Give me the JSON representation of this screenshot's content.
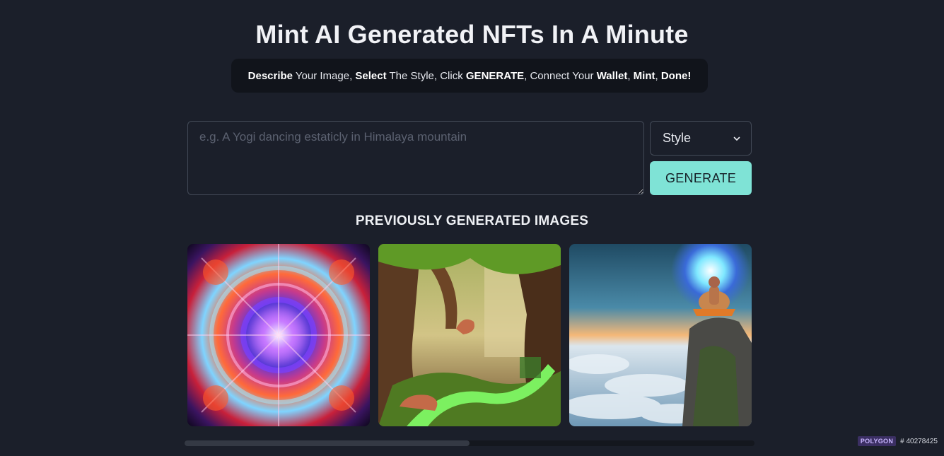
{
  "header": {
    "title": "Mint AI Generated NFTs In A Minute",
    "steps": [
      {
        "text": "Describe",
        "bold": true
      },
      {
        "text": " Your Image, ",
        "bold": false
      },
      {
        "text": "Select",
        "bold": true
      },
      {
        "text": " The Style, Click ",
        "bold": false
      },
      {
        "text": "GENERATE",
        "bold": true
      },
      {
        "text": ", Connect Your ",
        "bold": false
      },
      {
        "text": "Wallet",
        "bold": true
      },
      {
        "text": ", ",
        "bold": false
      },
      {
        "text": "Mint",
        "bold": true
      },
      {
        "text": ", ",
        "bold": false
      },
      {
        "text": "Done!",
        "bold": true
      }
    ]
  },
  "form": {
    "prompt_value": "",
    "prompt_placeholder": "e.g. A Yogi dancing estaticly in Himalaya mountain",
    "style_label": "Style",
    "style_icon": "chevron-down-icon",
    "generate_label": "GENERATE"
  },
  "gallery": {
    "title": "PREVIOUSLY GENERATED IMAGES",
    "images": [
      {
        "subject": "psychedelic cosmic mandala"
      },
      {
        "subject": "mystical forest with mushrooms"
      },
      {
        "subject": "yogi meditating above clouds"
      }
    ],
    "scroll_fraction": 0.5
  },
  "footer": {
    "network": "POLYGON",
    "block": "# 40278425"
  },
  "colors": {
    "background": "#1b1f2a",
    "accent": "#7fe3d6",
    "panel": "#11141b"
  }
}
